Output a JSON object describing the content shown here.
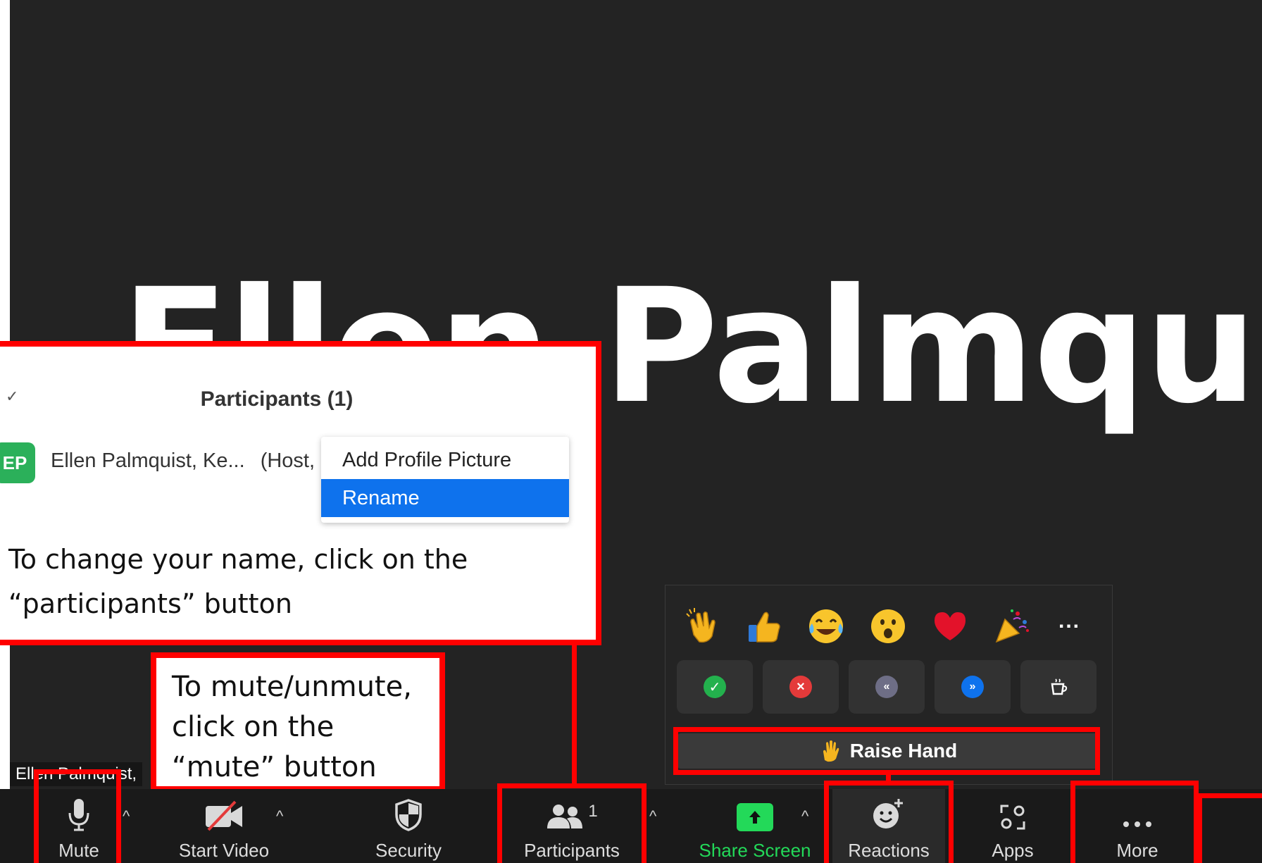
{
  "video": {
    "display_name": "Ellen Palmquist,..",
    "name_tag": "Ellen Palmquist,"
  },
  "participants_panel": {
    "collapse_glyph": "✓",
    "title": "Participants (1)",
    "avatar_initials": "EP",
    "participant_name": "Ellen Palmquist, Ke...",
    "participant_role": "(Host, r"
  },
  "context_menu": {
    "items": [
      "Add Profile Picture",
      "Rename"
    ],
    "selected_index": 1
  },
  "callouts": {
    "participants_line1": "To change your name, click on the",
    "participants_line2": "“participants” button",
    "mute_line1": "To mute/unmute,",
    "mute_line2": "click on the",
    "mute_line3": "“mute” button"
  },
  "reactions_panel": {
    "emojis": [
      "clapping-hands",
      "thumbs-up",
      "tears-of-joy",
      "open-mouth",
      "red-heart",
      "party-popper",
      "more"
    ],
    "more_label": "...",
    "status_buttons": [
      "yes-check",
      "no-x",
      "slow-down",
      "speed-up",
      "coffee-break"
    ],
    "raise_hand_label": "Raise Hand"
  },
  "toolbar": {
    "mute_label": "Mute",
    "video_label": "Start Video",
    "security_label": "Security",
    "participants_label": "Participants",
    "participants_count": "1",
    "share_label": "Share Screen",
    "reactions_label": "Reactions",
    "apps_label": "Apps",
    "more_label": "More",
    "caret": "^"
  },
  "colors": {
    "annotation_red": "#ff0000",
    "share_green": "#23d959",
    "selection_blue": "#0e72ed",
    "avatar_green": "#2bb05a"
  }
}
